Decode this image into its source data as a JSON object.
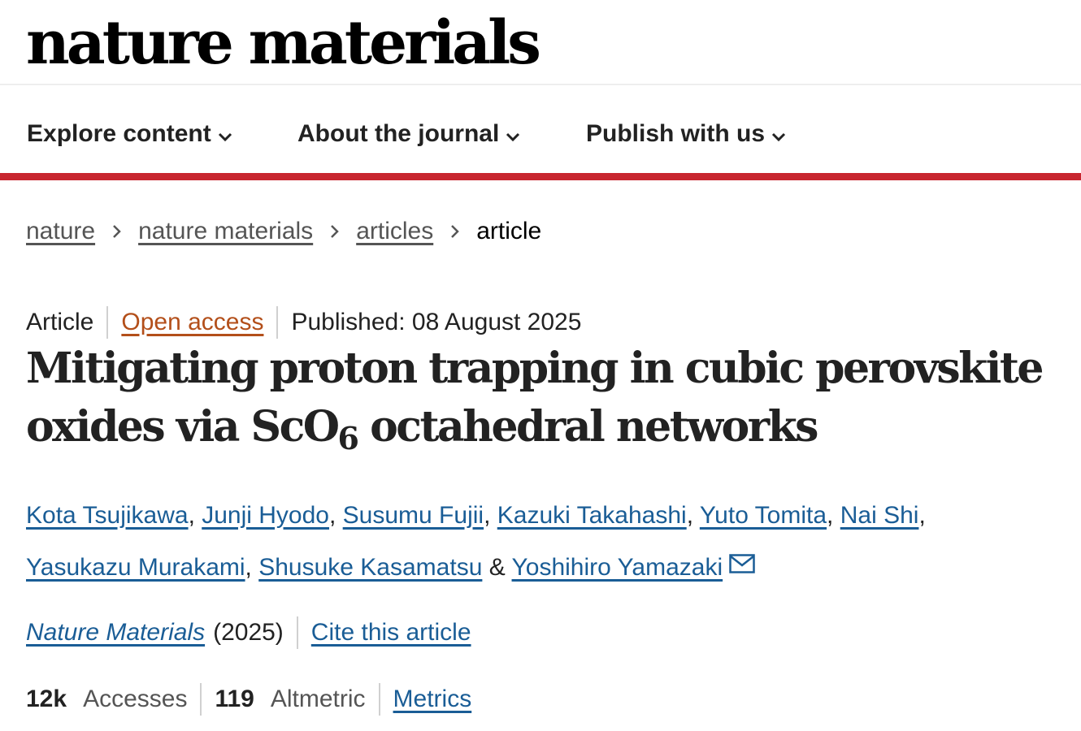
{
  "logo": "nature materials",
  "nav": [
    {
      "label": "Explore content",
      "icon": "chevron-down-icon"
    },
    {
      "label": "About the journal",
      "icon": "chevron-down-icon"
    },
    {
      "label": "Publish with us",
      "icon": "chevron-down-icon"
    }
  ],
  "colors": {
    "accent_bar": "#c8262f",
    "link": "#1a5d96",
    "open_access": "#b34f1a"
  },
  "breadcrumb": [
    "nature",
    "nature materials",
    "articles",
    "article"
  ],
  "article": {
    "type": "Article",
    "access": "Open access",
    "published": "Published: 08 August 2025",
    "title_part1": "Mitigating proton trapping in cubic perovskite oxides via ScO",
    "title_sub": "6",
    "title_part2": " octahedral networks",
    "authors": [
      "Kota Tsujikawa",
      "Junji Hyodo",
      "Susumu Fujii",
      "Kazuki Takahashi",
      "Yuto Tomita",
      "Nai Shi",
      "Yasukazu Murakami",
      "Shusuke Kasamatsu",
      "Yoshihiro Yamazaki"
    ],
    "author_sep": ", ",
    "author_last_sep": " & ",
    "contact_icon": "mail-icon",
    "journal": "Nature Materials",
    "year": "(2025)",
    "cite": "Cite this article",
    "accesses_value": "12k",
    "accesses_label": "Accesses",
    "altmetric_value": "119",
    "altmetric_label": "Altmetric",
    "metrics_link": "Metrics"
  }
}
